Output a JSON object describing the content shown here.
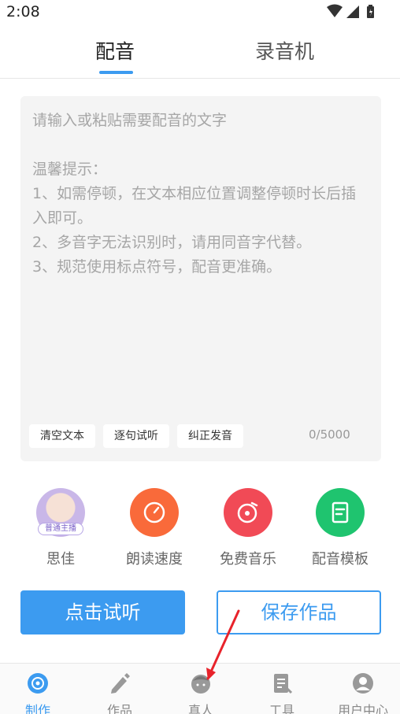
{
  "status_bar": {
    "time": "2:08",
    "icons": [
      "wifi-icon",
      "signal-icon",
      "battery-icon"
    ]
  },
  "tabs": [
    {
      "label": "配音",
      "active": true
    },
    {
      "label": "录音机",
      "active": false
    }
  ],
  "editor": {
    "placeholder": "请输入或粘贴需要配音的文字\n\n温馨提示：\n1、如需停顿，在文本相应位置调整停顿时长后插入即可。\n2、多音字无法识别时，请用同音字代替。\n3、规范使用标点符号，配音更准确。",
    "chips": {
      "clear": "清空文本",
      "trial": "逐句试听",
      "fix": "纠正发音"
    },
    "counter": "0/5000"
  },
  "features": {
    "voice": {
      "name": "思佳",
      "badge": "普通主播"
    },
    "speed": {
      "label": "朗读速度"
    },
    "music": {
      "label": "免费音乐"
    },
    "template": {
      "label": "配音模板"
    }
  },
  "buttons": {
    "listen": "点击试听",
    "save": "保存作品"
  },
  "bottom_nav": {
    "make": "制作",
    "works": "作品",
    "real": "真人",
    "tools": "工具",
    "user": "用户中心"
  },
  "colors": {
    "accent": "#3c9bf0",
    "orange": "#f96a3a",
    "red": "#f14a56",
    "green": "#1fc46f",
    "annotation": "#e8232b"
  }
}
